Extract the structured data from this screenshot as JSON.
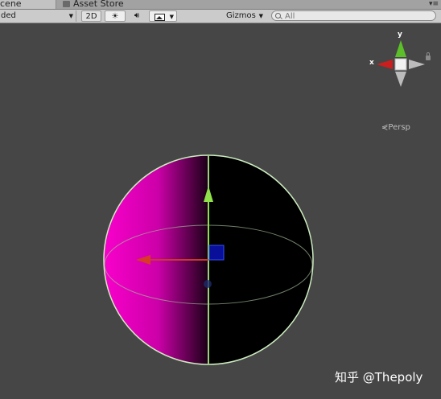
{
  "tabs": {
    "scene": "cene",
    "asset_store": "Asset Store"
  },
  "toolbar": {
    "shading_mode": "ded",
    "mode_2d": "2D",
    "gizmos": "Gizmos",
    "search_placeholder": "All"
  },
  "view": {
    "projection_label": "Persp",
    "axis_x": "x",
    "axis_y": "y"
  },
  "watermark": "知乎 @Thepoly",
  "colors": {
    "background": "#464646",
    "sphere_lit": "#ff00cc",
    "sphere_dark": "#000000",
    "gizmo_x": "#e02020",
    "gizmo_y": "#7adf3a",
    "selection_wire": "#c8f0b0"
  }
}
